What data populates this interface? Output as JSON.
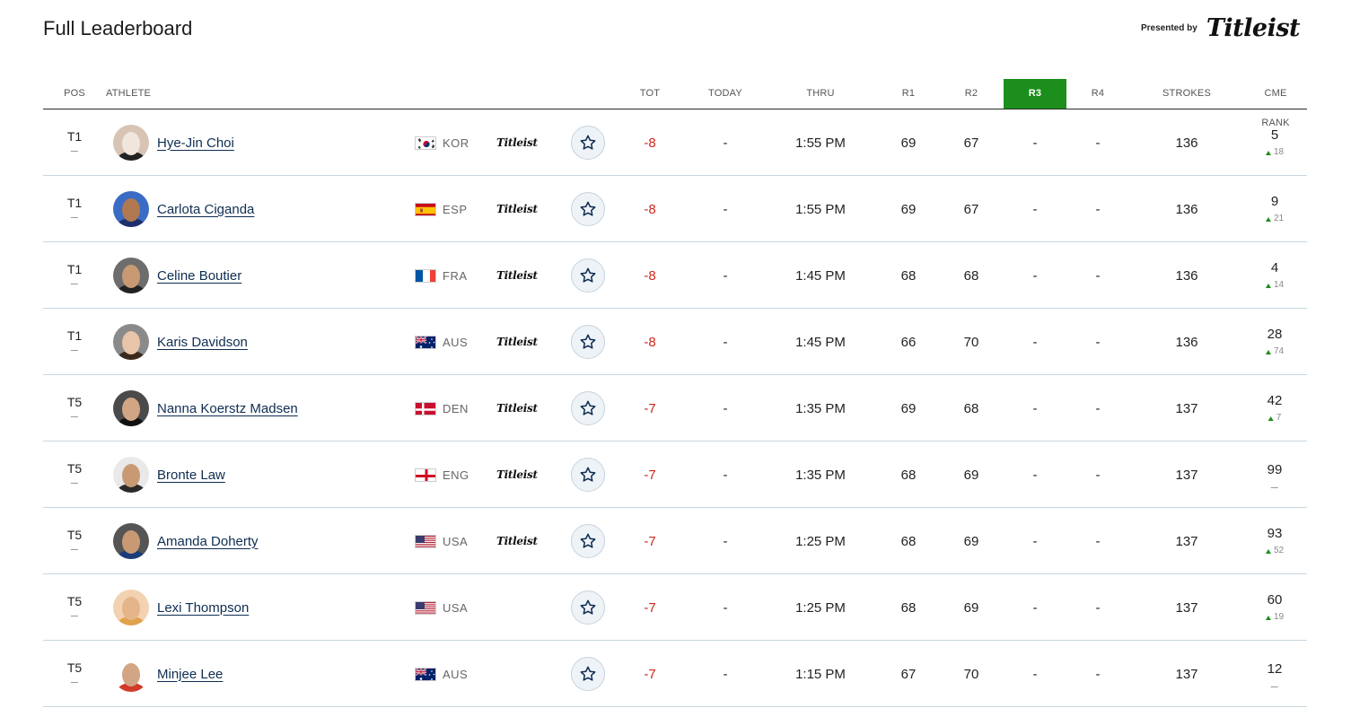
{
  "page": {
    "title": "Full Leaderboard"
  },
  "sponsor": {
    "presented_by": "Presented by",
    "brand": "Titleist"
  },
  "columns": {
    "pos": "POS",
    "athlete": "ATHLETE",
    "tot": "TOT",
    "today": "TODAY",
    "thru": "THRU",
    "r1": "R1",
    "r2": "R2",
    "r3": "R3",
    "r4": "R4",
    "strokes": "STROKES",
    "cme_rank": "CME RANK"
  },
  "active_round": "R3",
  "colors": {
    "accent_green": "#1b8e1b",
    "score_red": "#d0271d",
    "link_navy": "#0f2d52"
  },
  "rows": [
    {
      "pos": "T1",
      "name": "Hye-Jin Choi",
      "country": "KOR",
      "flag": "KOR",
      "brand": "Titleist",
      "tot": "-8",
      "today": "-",
      "thru": "1:55 PM",
      "r1": "69",
      "r2": "67",
      "r3": "-",
      "r4": "-",
      "strokes": "136",
      "cme_rank": "5",
      "cme_move": "18"
    },
    {
      "pos": "T1",
      "name": "Carlota Ciganda",
      "country": "ESP",
      "flag": "ESP",
      "brand": "Titleist",
      "tot": "-8",
      "today": "-",
      "thru": "1:55 PM",
      "r1": "69",
      "r2": "67",
      "r3": "-",
      "r4": "-",
      "strokes": "136",
      "cme_rank": "9",
      "cme_move": "21"
    },
    {
      "pos": "T1",
      "name": "Celine Boutier",
      "country": "FRA",
      "flag": "FRA",
      "brand": "Titleist",
      "tot": "-8",
      "today": "-",
      "thru": "1:45 PM",
      "r1": "68",
      "r2": "68",
      "r3": "-",
      "r4": "-",
      "strokes": "136",
      "cme_rank": "4",
      "cme_move": "14"
    },
    {
      "pos": "T1",
      "name": "Karis Davidson",
      "country": "AUS",
      "flag": "AUS",
      "brand": "Titleist",
      "tot": "-8",
      "today": "-",
      "thru": "1:45 PM",
      "r1": "66",
      "r2": "70",
      "r3": "-",
      "r4": "-",
      "strokes": "136",
      "cme_rank": "28",
      "cme_move": "74"
    },
    {
      "pos": "T5",
      "name": "Nanna Koerstz Madsen",
      "country": "DEN",
      "flag": "DEN",
      "brand": "Titleist",
      "tot": "-7",
      "today": "-",
      "thru": "1:35 PM",
      "r1": "69",
      "r2": "68",
      "r3": "-",
      "r4": "-",
      "strokes": "137",
      "cme_rank": "42",
      "cme_move": "7"
    },
    {
      "pos": "T5",
      "name": "Bronte Law",
      "country": "ENG",
      "flag": "ENG",
      "brand": "Titleist",
      "tot": "-7",
      "today": "-",
      "thru": "1:35 PM",
      "r1": "68",
      "r2": "69",
      "r3": "-",
      "r4": "-",
      "strokes": "137",
      "cme_rank": "99",
      "cme_move": ""
    },
    {
      "pos": "T5",
      "name": "Amanda Doherty",
      "country": "USA",
      "flag": "USA",
      "brand": "Titleist",
      "tot": "-7",
      "today": "-",
      "thru": "1:25 PM",
      "r1": "68",
      "r2": "69",
      "r3": "-",
      "r4": "-",
      "strokes": "137",
      "cme_rank": "93",
      "cme_move": "52"
    },
    {
      "pos": "T5",
      "name": "Lexi Thompson",
      "country": "USA",
      "flag": "USA",
      "brand": "",
      "tot": "-7",
      "today": "-",
      "thru": "1:25 PM",
      "r1": "68",
      "r2": "69",
      "r3": "-",
      "r4": "-",
      "strokes": "137",
      "cme_rank": "60",
      "cme_move": "19"
    },
    {
      "pos": "T5",
      "name": "Minjee Lee",
      "country": "AUS",
      "flag": "AUS",
      "brand": "",
      "tot": "-7",
      "today": "-",
      "thru": "1:15 PM",
      "r1": "67",
      "r2": "70",
      "r3": "-",
      "r4": "-",
      "strokes": "137",
      "cme_rank": "12",
      "cme_move": ""
    }
  ]
}
